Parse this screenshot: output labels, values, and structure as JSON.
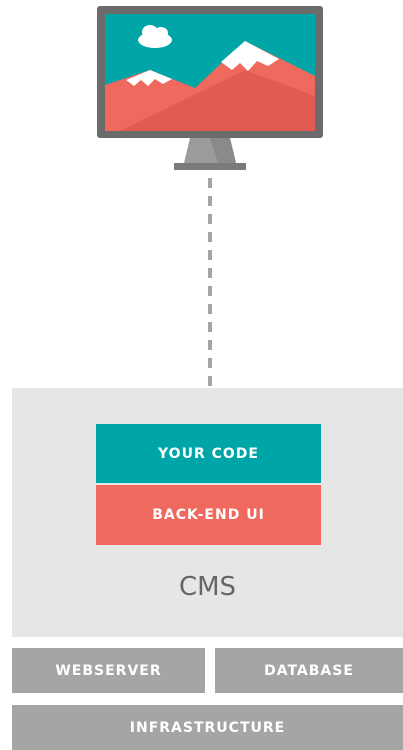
{
  "monitor": {
    "screen_color": "#00a5a7",
    "mountain_color": "#f0695f",
    "frame_color": "#6b6b6b",
    "snow_color": "#ffffff"
  },
  "stack": {
    "your_code": "YOUR CODE",
    "back_end_ui": "BACK-END UI",
    "cms": "CMS",
    "webserver": "WEBSERVER",
    "database": "DATABASE",
    "infrastructure": "INFRASTRUCTURE"
  },
  "colors": {
    "teal": "#00a5a7",
    "coral": "#f0695f",
    "panel": "#e6e6e6",
    "grey_block": "#a5a5a5",
    "connector": "#a5a5a5"
  }
}
